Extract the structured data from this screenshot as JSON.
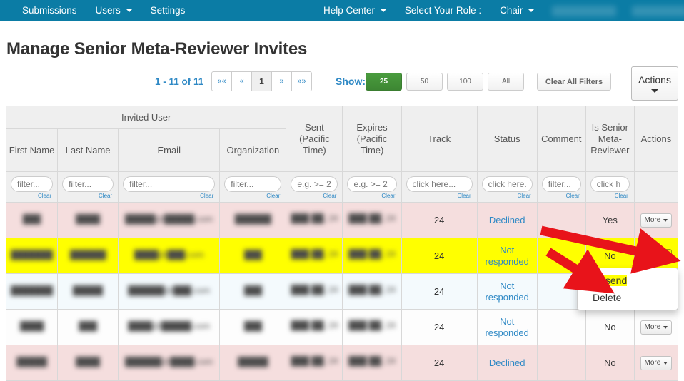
{
  "navbar": {
    "background": "#0b7ca5",
    "left_items": [
      {
        "label": "Submissions",
        "caret": false
      },
      {
        "label": "Users",
        "caret": true
      },
      {
        "label": "Settings",
        "caret": false
      }
    ],
    "right_items": [
      {
        "label": "Help Center",
        "caret": true
      },
      {
        "label": "Select Your Role :",
        "caret": false
      },
      {
        "label": "Chair",
        "caret": true
      }
    ],
    "redacted_count": 2
  },
  "page": {
    "title": "Manage Senior Meta-Reviewer Invites"
  },
  "toolbar": {
    "range_label": "1 - 11 of 11",
    "pager": [
      {
        "label": "««",
        "active": false
      },
      {
        "label": "«",
        "active": false
      },
      {
        "label": "1",
        "active": true
      },
      {
        "label": "»",
        "active": false
      },
      {
        "label": "»»",
        "active": false
      }
    ],
    "show_label": "Show:",
    "show_options": [
      {
        "label": "25",
        "selected": true
      },
      {
        "label": "50",
        "selected": false
      },
      {
        "label": "100",
        "selected": false
      },
      {
        "label": "All",
        "selected": false
      }
    ],
    "clear_all_filters": "Clear All Filters",
    "actions_label": "Actions",
    "selected_accent": "#3d8733",
    "link_color": "#2f89c5"
  },
  "table": {
    "group_header": "Invited User",
    "columns": [
      {
        "key": "first_name",
        "label": "First Name"
      },
      {
        "key": "last_name",
        "label": "Last Name"
      },
      {
        "key": "email",
        "label": "Email"
      },
      {
        "key": "organization",
        "label": "Organization"
      },
      {
        "key": "sent",
        "label": "Sent (Pacific Time)"
      },
      {
        "key": "expires",
        "label": "Expires (Pacific Time)"
      },
      {
        "key": "track",
        "label": "Track"
      },
      {
        "key": "status",
        "label": "Status"
      },
      {
        "key": "comment",
        "label": "Comment"
      },
      {
        "key": "is_senior_meta_reviewer",
        "label": "Is Senior Meta-Reviewer"
      },
      {
        "key": "actions",
        "label": "Actions"
      }
    ],
    "filters": [
      {
        "placeholder": "filter...",
        "value": "",
        "clear": "Clear"
      },
      {
        "placeholder": "filter...",
        "value": "",
        "clear": "Clear"
      },
      {
        "placeholder": "filter...",
        "value": "",
        "clear": "Clear"
      },
      {
        "placeholder": "filter...",
        "value": "",
        "clear": "Clear"
      },
      {
        "placeholder": "e.g. >= 2",
        "value": "",
        "clear": "Clear"
      },
      {
        "placeholder": "e.g. >= 2",
        "value": "",
        "clear": "Clear"
      },
      {
        "placeholder": "click here...",
        "value": "",
        "clear": "Clear"
      },
      {
        "placeholder": "click here.",
        "value": "",
        "clear": "Clear"
      },
      {
        "placeholder": "filter...",
        "value": "",
        "clear": "Clear"
      },
      {
        "placeholder": "click h",
        "value": "",
        "clear": "Clear"
      },
      {
        "placeholder": "",
        "value": "",
        "clear": ""
      }
    ],
    "rows": [
      {
        "style": "pink",
        "first_name": "███",
        "last_name": "████",
        "email": "█████@█████.com",
        "organization": "██████",
        "sent": "███ ██, 24",
        "expires": "███ ██, 24",
        "track": "24",
        "status": "Declined",
        "comment": "",
        "is_senior_meta_reviewer": "Yes",
        "action_label": "More"
      },
      {
        "style": "yellow",
        "first_name": "███████",
        "last_name": "██████",
        "email": "████@███.com",
        "organization": "███",
        "sent": "███ ██, 24",
        "expires": "███ ██, 24",
        "track": "24",
        "status": "Not responded",
        "comment": "",
        "is_senior_meta_reviewer": "No",
        "action_label": "More"
      },
      {
        "style": "blue",
        "first_name": "███████",
        "last_name": "█████",
        "email": "██████@███.com",
        "organization": "███",
        "sent": "███ ██, 24",
        "expires": "███ ██, 24",
        "track": "24",
        "status": "Not responded",
        "comment": "",
        "is_senior_meta_reviewer": "No",
        "action_label": "More"
      },
      {
        "style": "white",
        "first_name": "████",
        "last_name": "███",
        "email": "████@█████.com",
        "organization": "███",
        "sent": "███ ██, 24",
        "expires": "███ ██, 24",
        "track": "24",
        "status": "Not responded",
        "comment": "",
        "is_senior_meta_reviewer": "No",
        "action_label": "More"
      },
      {
        "style": "pink",
        "first_name": "█████",
        "last_name": "████",
        "email": "██████@████.com",
        "organization": "█████",
        "sent": "███ ██, 24",
        "expires": "███ ██, 24",
        "track": "24",
        "status": "Declined",
        "comment": "",
        "is_senior_meta_reviewer": "No",
        "action_label": "More"
      }
    ]
  },
  "dropdown": {
    "items": [
      {
        "label": "Resend",
        "highlighted": true
      },
      {
        "label": "Delete",
        "highlighted": false
      }
    ]
  },
  "annotations": {
    "arrow_color": "#e8131a",
    "arrow_count": 2
  }
}
